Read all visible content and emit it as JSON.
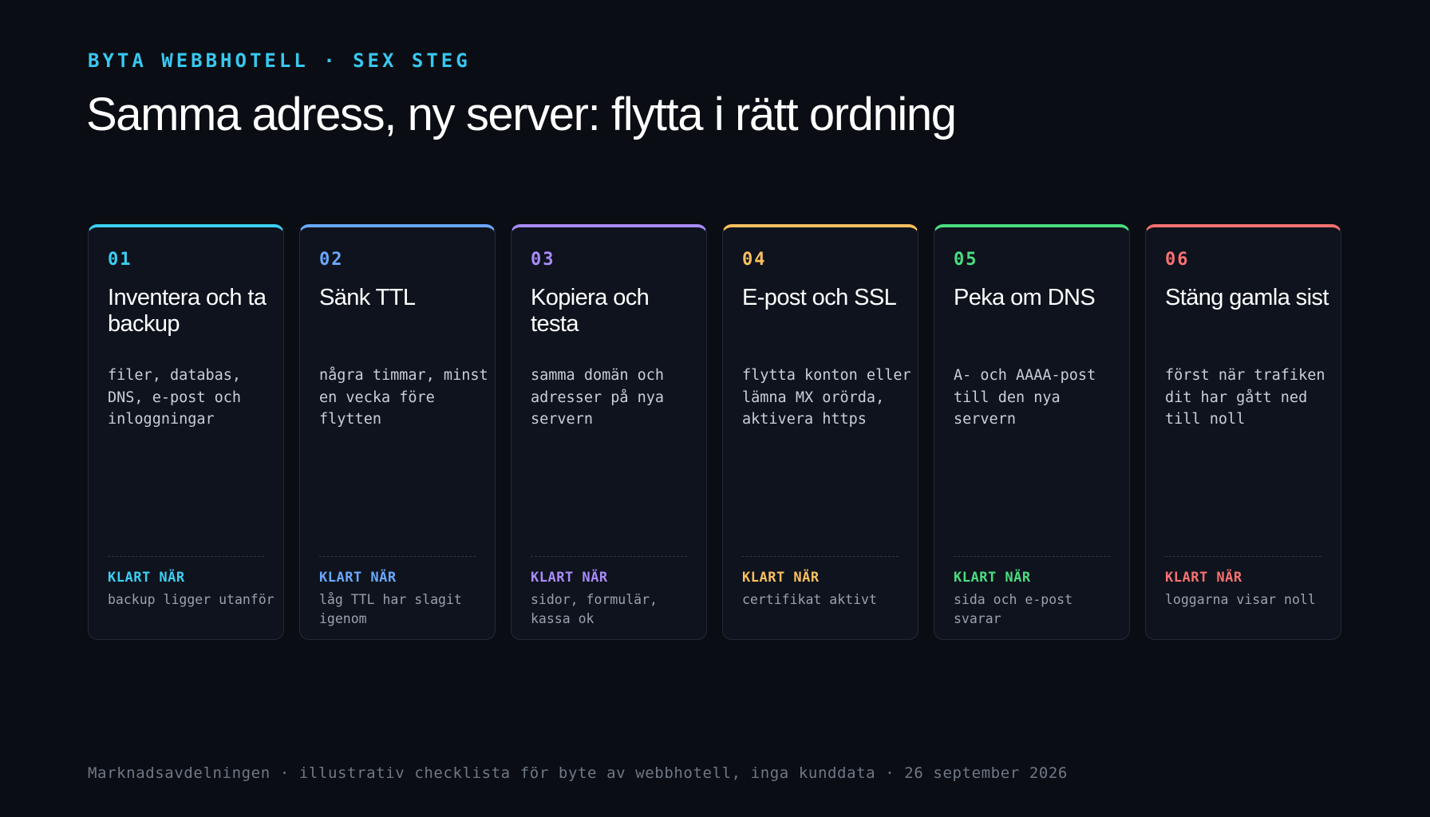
{
  "header": {
    "eyebrow": "BYTA WEBBHOTELL · SEX STEG",
    "title": "Samma adress, ny server: flytta i rätt ordning"
  },
  "steps": [
    {
      "number": "01",
      "title": "Inventera och ta backup",
      "description": "filer, databas, DNS, e-post och inloggningar",
      "done_label": "KLART NÄR",
      "done_text": "backup ligger utanför",
      "color": "#3ccff2"
    },
    {
      "number": "02",
      "title": "Sänk TTL",
      "description": "några timmar, minst en vecka före flytten",
      "done_label": "KLART NÄR",
      "done_text": "låg TTL har slagit igenom",
      "color": "#6aa8ff"
    },
    {
      "number": "03",
      "title": "Kopiera och testa",
      "description": "samma domän och adresser på nya servern",
      "done_label": "KLART NÄR",
      "done_text": "sidor, formulär, kassa ok",
      "color": "#a98bfa"
    },
    {
      "number": "04",
      "title": "E-post och SSL",
      "description": "flytta konton eller lämna MX orörda, aktivera https",
      "done_label": "KLART NÄR",
      "done_text": "certifikat aktivt",
      "color": "#fcbf5f"
    },
    {
      "number": "05",
      "title": "Peka om DNS",
      "description": "A- och AAAA-post till den nya servern",
      "done_label": "KLART NÄR",
      "done_text": "sida och e-post svarar",
      "color": "#4ade80"
    },
    {
      "number": "06",
      "title": "Stäng gamla sist",
      "description": "först när trafiken dit har gått ned till noll",
      "done_label": "KLART NÄR",
      "done_text": "loggarna visar noll",
      "color": "#f87171"
    }
  ],
  "footer": {
    "text": "Marknadsavdelningen · illustrativ checklista för byte av webbhotell, inga kunddata · 26 september 2026"
  }
}
